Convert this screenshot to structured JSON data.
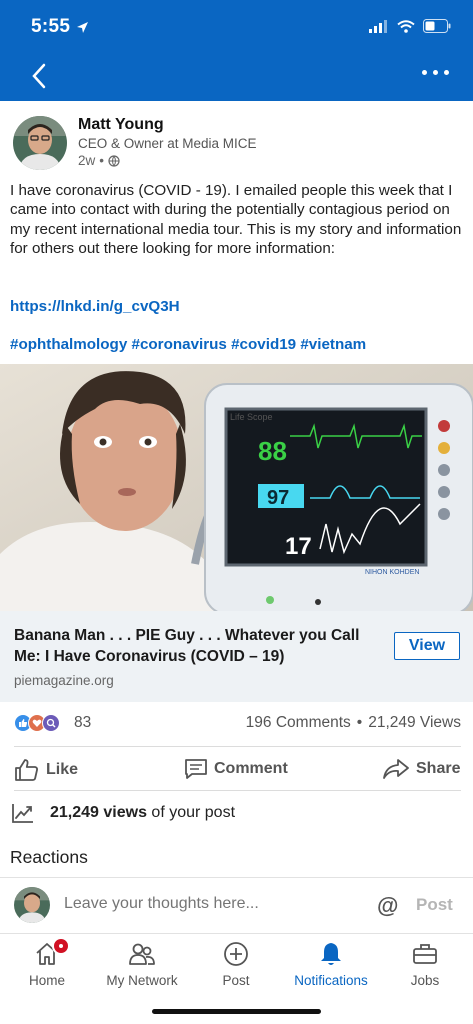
{
  "status_bar": {
    "time": "5:55"
  },
  "nav": {
    "back_icon": "chevron-left-icon",
    "more_icon": "more-icon"
  },
  "author": {
    "name": "Matt Young",
    "title": "CEO & Owner at Media MICE",
    "time": "2w",
    "separator": "•",
    "visibility_icon": "globe-icon"
  },
  "post": {
    "text": "I have coronavirus (COVID - 19). I emailed people this week that I came into contact with during the potentially contagious period on my recent international media tour. This is my story and information for others out there looking for more information:",
    "link": "https://lnkd.in/g_cvQ3H",
    "hashtags": "#ophthalmology #coronavirus #covid19 #vietnam"
  },
  "image": {
    "monitor_brand": "Life Scope",
    "monitor_maker": "NIHON KOHDEN",
    "readings": [
      "88",
      "97",
      "17"
    ]
  },
  "article": {
    "title": "Banana Man . . . PIE Guy . . . Whatever you Call Me: I Have Coronavirus (COVID – 19)",
    "source": "piemagazine.org",
    "view_label": "View"
  },
  "social": {
    "reaction_count": "83",
    "comments": "196 Comments",
    "dot": "•",
    "views": "21,249 Views",
    "reaction_colors": {
      "like": "#378fe9",
      "love": "#df704d",
      "curious": "#6c5bb8"
    }
  },
  "actions": {
    "like": "Like",
    "comment": "Comment",
    "share": "Share"
  },
  "post_views": {
    "count": "21,249 views",
    "suffix": "of your post"
  },
  "reactions_heading": "Reactions",
  "comment_bar": {
    "placeholder": "Leave your thoughts here...",
    "at": "@",
    "post_label": "Post"
  },
  "tabs": [
    {
      "label": "Home",
      "icon": "home-icon"
    },
    {
      "label": "My Network",
      "icon": "network-icon"
    },
    {
      "label": "Post",
      "icon": "plus-circle-icon"
    },
    {
      "label": "Notifications",
      "icon": "bell-icon",
      "active": true
    },
    {
      "label": "Jobs",
      "icon": "briefcase-icon"
    }
  ],
  "colors": {
    "brand": "#0a66c2",
    "badge": "#d11124"
  }
}
